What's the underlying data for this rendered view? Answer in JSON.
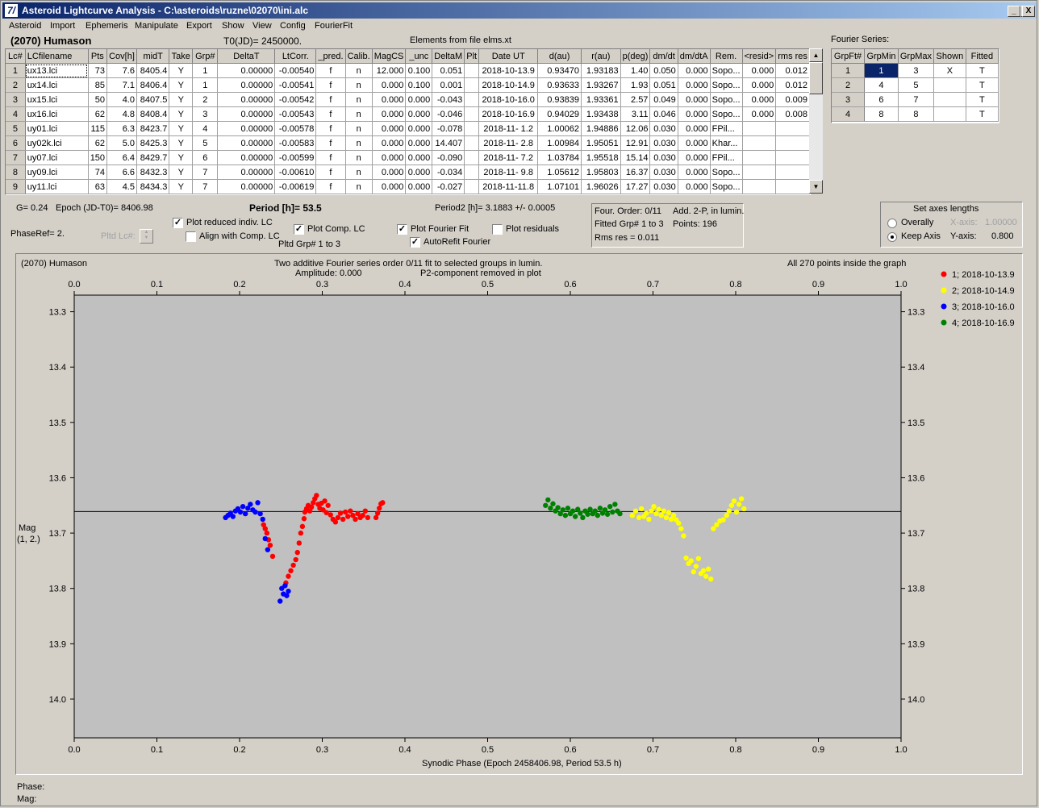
{
  "window": {
    "title": "Asteroid Lightcurve Analysis - C:\\asteroids\\ruzne\\02070\\ini.alc",
    "app_icon": "7/",
    "buttons": {
      "minimize": "_",
      "maximize": "□",
      "close": "X"
    }
  },
  "menu": [
    "Asteroid",
    "Import",
    "Ephemeris",
    "Manipulate",
    "Export",
    "Show",
    "View",
    "Config",
    "FourierFit"
  ],
  "header": {
    "asteroid_name": "(2070) Humason",
    "t0": "T0(JD)= 2450000.",
    "elements": "Elements from file elms.xt",
    "fourier_series_label": "Fourier Series:"
  },
  "lc_table": {
    "columns": [
      "Lc#",
      "LCfilename",
      "Pts",
      "Cov[h]",
      "midT",
      "Take",
      "Grp#",
      "DeltaT",
      "LtCorr.",
      "_pred.",
      "Calib.",
      "MagCS",
      "_unc",
      "DeltaM",
      "Plt",
      "Date UT",
      "d(au)",
      "r(au)",
      "p(deg)",
      "dm/dt",
      "dm/dtA",
      "Rem.",
      "<resid>",
      "rms res"
    ],
    "rows": [
      [
        "1",
        "ux13.lci",
        "73",
        "7.6",
        "8405.4",
        "Y",
        "1",
        "0.00000",
        "-0.00540",
        "f",
        "n",
        "12.000",
        "0.100",
        "0.051",
        "",
        "2018-10-13.9",
        "0.93470",
        "1.93183",
        "1.40",
        "0.050",
        "0.000",
        "Sopo...",
        "0.000",
        "0.012"
      ],
      [
        "2",
        "ux14.lci",
        "85",
        "7.1",
        "8406.4",
        "Y",
        "1",
        "0.00000",
        "-0.00541",
        "f",
        "n",
        "0.000",
        "0.100",
        "0.001",
        "",
        "2018-10-14.9",
        "0.93633",
        "1.93267",
        "1.93",
        "0.051",
        "0.000",
        "Sopo...",
        "0.000",
        "0.012"
      ],
      [
        "3",
        "ux15.lci",
        "50",
        "4.0",
        "8407.5",
        "Y",
        "2",
        "0.00000",
        "-0.00542",
        "f",
        "n",
        "0.000",
        "0.000",
        "-0.043",
        "",
        "2018-10-16.0",
        "0.93839",
        "1.93361",
        "2.57",
        "0.049",
        "0.000",
        "Sopo...",
        "0.000",
        "0.009"
      ],
      [
        "4",
        "ux16.lci",
        "62",
        "4.8",
        "8408.4",
        "Y",
        "3",
        "0.00000",
        "-0.00543",
        "f",
        "n",
        "0.000",
        "0.000",
        "-0.046",
        "",
        "2018-10-16.9",
        "0.94029",
        "1.93438",
        "3.11",
        "0.046",
        "0.000",
        "Sopo...",
        "0.000",
        "0.008"
      ],
      [
        "5",
        "uy01.lci",
        "115",
        "6.3",
        "8423.7",
        "Y",
        "4",
        "0.00000",
        "-0.00578",
        "f",
        "n",
        "0.000",
        "0.000",
        "-0.078",
        "",
        "2018-11- 1.2",
        "1.00062",
        "1.94886",
        "12.06",
        "0.030",
        "0.000",
        "FPil...",
        "",
        ""
      ],
      [
        "6",
        "uy02k.lci",
        "62",
        "5.0",
        "8425.3",
        "Y",
        "5",
        "0.00000",
        "-0.00583",
        "f",
        "n",
        "0.000",
        "0.000",
        "14.407",
        "",
        "2018-11- 2.8",
        "1.00984",
        "1.95051",
        "12.91",
        "0.030",
        "0.000",
        "Khar...",
        "",
        ""
      ],
      [
        "7",
        "uy07.lci",
        "150",
        "6.4",
        "8429.7",
        "Y",
        "6",
        "0.00000",
        "-0.00599",
        "f",
        "n",
        "0.000",
        "0.000",
        "-0.090",
        "",
        "2018-11- 7.2",
        "1.03784",
        "1.95518",
        "15.14",
        "0.030",
        "0.000",
        "FPil...",
        "",
        ""
      ],
      [
        "8",
        "uy09.lci",
        "74",
        "6.6",
        "8432.3",
        "Y",
        "7",
        "0.00000",
        "-0.00610",
        "f",
        "n",
        "0.000",
        "0.000",
        "-0.034",
        "",
        "2018-11- 9.8",
        "1.05612",
        "1.95803",
        "16.37",
        "0.030",
        "0.000",
        "Sopo...",
        "",
        ""
      ],
      [
        "9",
        "uy11.lci",
        "63",
        "4.5",
        "8434.3",
        "Y",
        "7",
        "0.00000",
        "-0.00619",
        "f",
        "n",
        "0.000",
        "0.000",
        "-0.027",
        "",
        "2018-11-11.8",
        "1.07101",
        "1.96026",
        "17.27",
        "0.030",
        "0.000",
        "Sopo...",
        "",
        ""
      ]
    ]
  },
  "fourier_table": {
    "columns": [
      "GrpFt#",
      "GrpMin",
      "GrpMax",
      "Shown",
      "Fitted"
    ],
    "rows": [
      [
        "1",
        "1",
        "3",
        "X",
        "T"
      ],
      [
        "2",
        "4",
        "5",
        "",
        "T"
      ],
      [
        "3",
        "6",
        "7",
        "",
        "T"
      ],
      [
        "4",
        "8",
        "8",
        "",
        "T"
      ]
    ]
  },
  "controls": {
    "g": "G= 0.24",
    "epoch": "Epoch (JD-T0)= 8406.98",
    "period": "Period [h]= 53.5",
    "period2": "Period2 [h]= 3.1883 +/- 0.0005",
    "phaseref": "PhaseRef= 2.",
    "pltd_lc": "Pltd Lc#:",
    "plot_reduced": "Plot reduced indiv. LC",
    "align_comp": "Align with Comp. LC",
    "plot_comp": "Plot Comp. LC",
    "pltd_grp": "Pltd Grp#  1   to   3",
    "plot_fourier": "Plot Fourier Fit",
    "autorefit": "AutoRefit Fourier",
    "plot_residuals": "Plot residuals",
    "check": "✓"
  },
  "fit_info": {
    "order": "Four. Order:  0/11",
    "add": "Add. 2-P, in lumin.",
    "fitted_grp": "Fitted Grp# 1 to 3",
    "points": "Points: 196",
    "rms": "Rms res     = 0.011"
  },
  "axes_panel": {
    "title": "Set axes lengths",
    "overally": "Overally",
    "keep_axis": "Keep Axis",
    "x_label": "X-axis:",
    "x_value": "1.00000",
    "y_label": "Y-axis:",
    "y_value": "0.800"
  },
  "status": {
    "phase": "Phase:",
    "mag": "Mag:"
  },
  "colors": {
    "red": "#ff0000",
    "yellow": "#ffff00",
    "blue": "#0000ff",
    "green": "#008000",
    "plot_bg": "#c0c0c0"
  },
  "chart_data": {
    "type": "scatter",
    "title": "Two additive Fourier series order 0/11 fit to selected groups in lumin.",
    "subtitle_amp": "Amplitude: 0.000",
    "subtitle_p2": "P2-component removed in plot",
    "left_note": "(2070) Humason",
    "right_note": "All 270 points inside the graph",
    "xlabel": "Synodic Phase (Epoch 2458406.98, Period 53.5 h)",
    "ylabel": "Mag",
    "ylabel2": "(1, 2.)",
    "xlim": [
      0.0,
      1.0
    ],
    "ylim": [
      13.27,
      14.07
    ],
    "y_inverted": true,
    "x_ticks": [
      "0.0",
      "0.1",
      "0.2",
      "0.3",
      "0.4",
      "0.5",
      "0.6",
      "0.7",
      "0.8",
      "0.9",
      "1.0"
    ],
    "y_ticks": [
      "13.3",
      "13.4",
      "13.5",
      "13.6",
      "13.7",
      "13.8",
      "13.9",
      "14.0"
    ],
    "fit_line_y": 13.661,
    "series": [
      {
        "name": "1; 2018-10-13.9",
        "color": "#ff0000",
        "points": [
          [
            0.229,
            13.685
          ],
          [
            0.231,
            13.692
          ],
          [
            0.233,
            13.7
          ],
          [
            0.235,
            13.712
          ],
          [
            0.237,
            13.722
          ],
          [
            0.24,
            13.742
          ],
          [
            0.256,
            13.79
          ],
          [
            0.259,
            13.778
          ],
          [
            0.262,
            13.768
          ],
          [
            0.265,
            13.758
          ],
          [
            0.268,
            13.748
          ],
          [
            0.27,
            13.735
          ],
          [
            0.272,
            13.718
          ],
          [
            0.274,
            13.7
          ],
          [
            0.276,
            13.688
          ],
          [
            0.278,
            13.674
          ],
          [
            0.279,
            13.662
          ],
          [
            0.281,
            13.656
          ],
          [
            0.283,
            13.65
          ],
          [
            0.285,
            13.66
          ],
          [
            0.287,
            13.653
          ],
          [
            0.289,
            13.645
          ],
          [
            0.291,
            13.638
          ],
          [
            0.293,
            13.632
          ],
          [
            0.295,
            13.648
          ],
          [
            0.297,
            13.655
          ],
          [
            0.299,
            13.646
          ],
          [
            0.301,
            13.658
          ],
          [
            0.303,
            13.642
          ],
          [
            0.305,
            13.663
          ],
          [
            0.307,
            13.65
          ],
          [
            0.31,
            13.667
          ],
          [
            0.313,
            13.675
          ],
          [
            0.316,
            13.68
          ],
          [
            0.319,
            13.672
          ],
          [
            0.322,
            13.664
          ],
          [
            0.325,
            13.675
          ],
          [
            0.328,
            13.662
          ],
          [
            0.331,
            13.67
          ],
          [
            0.334,
            13.66
          ],
          [
            0.337,
            13.668
          ],
          [
            0.34,
            13.675
          ],
          [
            0.343,
            13.665
          ],
          [
            0.346,
            13.672
          ],
          [
            0.349,
            13.668
          ],
          [
            0.352,
            13.66
          ],
          [
            0.355,
            13.672
          ],
          [
            0.365,
            13.672
          ],
          [
            0.367,
            13.664
          ],
          [
            0.369,
            13.655
          ],
          [
            0.371,
            13.647
          ],
          [
            0.373,
            13.645
          ]
        ]
      },
      {
        "name": "2; 2018-10-14.9",
        "color": "#ffff00",
        "points": [
          [
            0.675,
            13.668
          ],
          [
            0.679,
            13.66
          ],
          [
            0.683,
            13.672
          ],
          [
            0.686,
            13.656
          ],
          [
            0.689,
            13.67
          ],
          [
            0.692,
            13.664
          ],
          [
            0.695,
            13.675
          ],
          [
            0.698,
            13.66
          ],
          [
            0.701,
            13.652
          ],
          [
            0.704,
            13.665
          ],
          [
            0.707,
            13.657
          ],
          [
            0.71,
            13.668
          ],
          [
            0.713,
            13.66
          ],
          [
            0.716,
            13.672
          ],
          [
            0.719,
            13.663
          ],
          [
            0.722,
            13.675
          ],
          [
            0.725,
            13.668
          ],
          [
            0.728,
            13.676
          ],
          [
            0.731,
            13.682
          ],
          [
            0.734,
            13.692
          ],
          [
            0.737,
            13.705
          ],
          [
            0.74,
            13.745
          ],
          [
            0.743,
            13.755
          ],
          [
            0.746,
            13.75
          ],
          [
            0.749,
            13.77
          ],
          [
            0.752,
            13.76
          ],
          [
            0.755,
            13.746
          ],
          [
            0.758,
            13.773
          ],
          [
            0.761,
            13.768
          ],
          [
            0.764,
            13.778
          ],
          [
            0.767,
            13.765
          ],
          [
            0.77,
            13.783
          ],
          [
            0.773,
            13.692
          ],
          [
            0.777,
            13.685
          ],
          [
            0.781,
            13.678
          ],
          [
            0.785,
            13.676
          ],
          [
            0.789,
            13.668
          ],
          [
            0.792,
            13.66
          ],
          [
            0.795,
            13.65
          ],
          [
            0.798,
            13.642
          ],
          [
            0.801,
            13.662
          ],
          [
            0.804,
            13.648
          ],
          [
            0.807,
            13.638
          ],
          [
            0.81,
            13.656
          ]
        ]
      },
      {
        "name": "3; 2018-10-16.0",
        "color": "#0000ff",
        "points": [
          [
            0.183,
            13.672
          ],
          [
            0.186,
            13.668
          ],
          [
            0.189,
            13.664
          ],
          [
            0.192,
            13.67
          ],
          [
            0.195,
            13.66
          ],
          [
            0.198,
            13.656
          ],
          [
            0.201,
            13.662
          ],
          [
            0.204,
            13.652
          ],
          [
            0.207,
            13.665
          ],
          [
            0.21,
            13.655
          ],
          [
            0.213,
            13.648
          ],
          [
            0.216,
            13.658
          ],
          [
            0.219,
            13.662
          ],
          [
            0.222,
            13.645
          ],
          [
            0.225,
            13.665
          ],
          [
            0.228,
            13.675
          ],
          [
            0.231,
            13.71
          ],
          [
            0.234,
            13.73
          ],
          [
            0.249,
            13.823
          ],
          [
            0.251,
            13.8
          ],
          [
            0.253,
            13.81
          ],
          [
            0.255,
            13.795
          ],
          [
            0.257,
            13.813
          ],
          [
            0.259,
            13.805
          ]
        ]
      },
      {
        "name": "4; 2018-10-16.9",
        "color": "#008000",
        "points": [
          [
            0.57,
            13.65
          ],
          [
            0.573,
            13.64
          ],
          [
            0.576,
            13.655
          ],
          [
            0.579,
            13.647
          ],
          [
            0.582,
            13.66
          ],
          [
            0.585,
            13.654
          ],
          [
            0.588,
            13.665
          ],
          [
            0.591,
            13.658
          ],
          [
            0.594,
            13.668
          ],
          [
            0.597,
            13.655
          ],
          [
            0.6,
            13.665
          ],
          [
            0.603,
            13.66
          ],
          [
            0.606,
            13.67
          ],
          [
            0.609,
            13.657
          ],
          [
            0.612,
            13.664
          ],
          [
            0.615,
            13.672
          ],
          [
            0.618,
            13.66
          ],
          [
            0.621,
            13.666
          ],
          [
            0.624,
            13.657
          ],
          [
            0.627,
            13.665
          ],
          [
            0.63,
            13.66
          ],
          [
            0.633,
            13.668
          ],
          [
            0.636,
            13.655
          ],
          [
            0.639,
            13.664
          ],
          [
            0.642,
            13.658
          ],
          [
            0.645,
            13.666
          ],
          [
            0.648,
            13.652
          ],
          [
            0.651,
            13.662
          ],
          [
            0.654,
            13.648
          ],
          [
            0.657,
            13.66
          ],
          [
            0.66,
            13.665
          ]
        ]
      }
    ]
  }
}
